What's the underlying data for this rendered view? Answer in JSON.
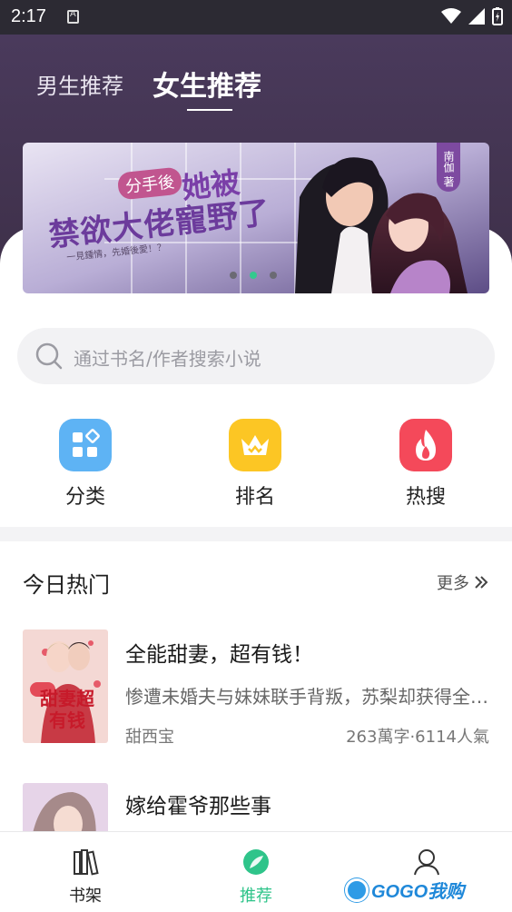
{
  "status_bar": {
    "time": "2:17"
  },
  "header": {
    "tabs": [
      {
        "label": "男生推荐",
        "active": false
      },
      {
        "label": "女生推荐",
        "active": true
      }
    ]
  },
  "banner": {
    "tag": "分手後",
    "title_line1": "她被",
    "title_line2": "禁欲大佬寵野了",
    "subtitle": "一見鍾情，先婚後愛！？",
    "author_label": "南伽 著",
    "slide_count": 3,
    "active_slide": 2
  },
  "search": {
    "placeholder": "通过书名/作者搜索小说"
  },
  "categories": [
    {
      "label": "分类",
      "icon": "grid-icon",
      "color": "#5eb3f4"
    },
    {
      "label": "排名",
      "icon": "crown-icon",
      "color": "#fcc624"
    },
    {
      "label": "热搜",
      "icon": "flame-icon",
      "color": "#f4495a"
    }
  ],
  "hot_section": {
    "title": "今日热门",
    "more_label": "更多",
    "books": [
      {
        "title": "全能甜妻，超有钱！",
        "description": "惨遭未婚夫与妹妹联手背叛，苏梨却获得全能系统",
        "author": "甜西宝",
        "stats": "263萬字·6114人氣",
        "cover_text": "甜妻超有钱"
      },
      {
        "title": "嫁给霍爷那些事",
        "description": "",
        "author": "",
        "stats": ""
      }
    ]
  },
  "bottom_nav": [
    {
      "label": "书架",
      "icon": "bookshelf-icon",
      "active": false
    },
    {
      "label": "推荐",
      "icon": "leaf-icon",
      "active": true,
      "color": "#2fc48a"
    },
    {
      "label": "我的",
      "icon": "person-icon",
      "active": false
    }
  ],
  "watermark": {
    "text": "GOGO我购"
  },
  "colors": {
    "accent": "#2fc48a",
    "header_bg": "#4a3a5c"
  }
}
